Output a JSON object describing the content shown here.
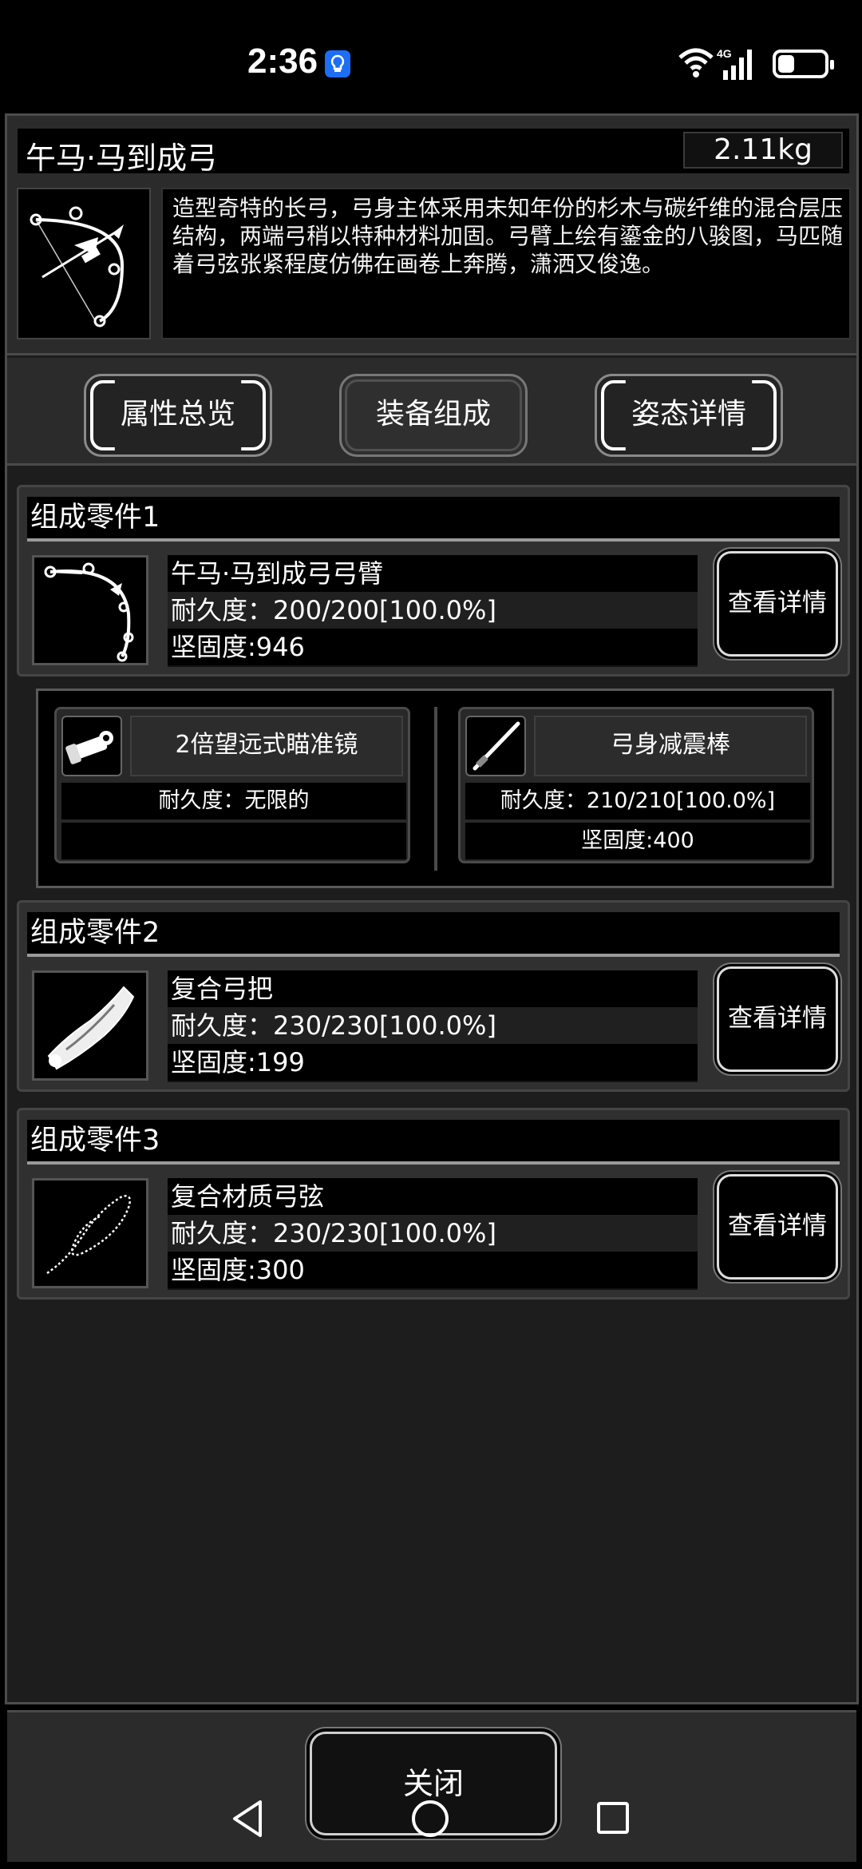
{
  "status_bar": {
    "time": "2:36",
    "network": "4G",
    "battery_level": 0.35
  },
  "item": {
    "name": "午马·马到成弓",
    "weight": "2.11kg",
    "icon": "bow-icon",
    "description": "造型奇特的长弓，弓身主体采用未知年份的杉木与碳纤维的混合层压结构，两端弓稍以特种材料加固。弓臂上绘有鎏金的八骏图，马匹随着弓弦张紧程度仿佛在画卷上奔腾，潇洒又俊逸。"
  },
  "tabs": [
    {
      "label": "属性总览",
      "active": false
    },
    {
      "label": "装备组成",
      "active": true
    },
    {
      "label": "姿态详情",
      "active": false
    }
  ],
  "parts": [
    {
      "title": "组成零件1",
      "name": "午马·马到成弓弓臂",
      "durability": "耐久度：200/200[100.0%]",
      "hardness": "坚固度:946",
      "icon": "bow-limb-icon",
      "button": "查看详情"
    },
    {
      "title": "组成零件2",
      "name": "复合弓把",
      "durability": "耐久度：230/230[100.0%]",
      "hardness": "坚固度:199",
      "icon": "bow-grip-icon",
      "button": "查看详情"
    },
    {
      "title": "组成零件3",
      "name": "复合材质弓弦",
      "durability": "耐久度：230/230[100.0%]",
      "hardness": "坚固度:300",
      "icon": "bow-string-icon",
      "button": "查看详情"
    }
  ],
  "accessories": [
    {
      "name": "2倍望远式瞄准镜",
      "durability": "耐久度：无限的",
      "hardness": "",
      "icon": "scope-icon"
    },
    {
      "name": "弓身减震棒",
      "durability": "耐久度：210/210[100.0%]",
      "hardness": "坚固度:400",
      "icon": "stabilizer-icon"
    }
  ],
  "close_button": "关闭"
}
